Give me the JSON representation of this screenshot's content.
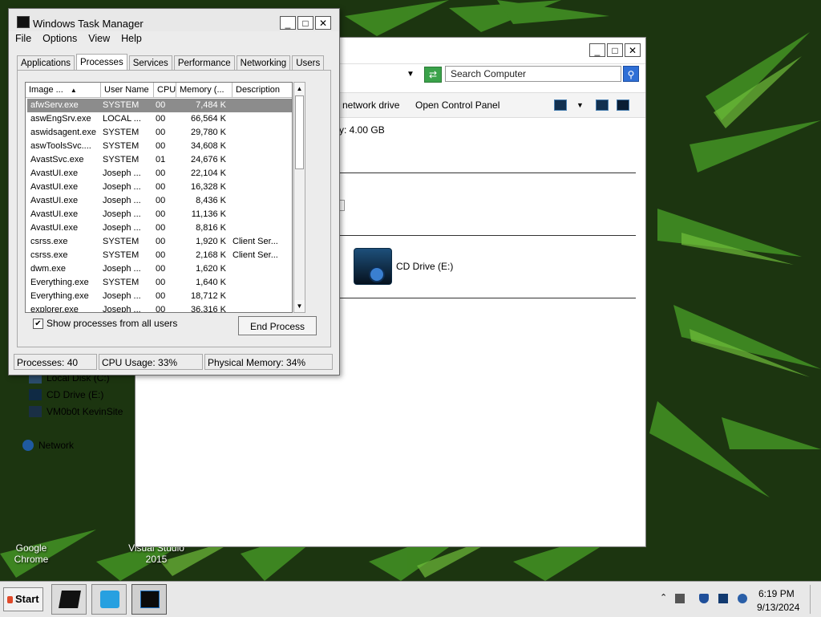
{
  "desktop": {
    "icons": [
      {
        "label1": "Google",
        "label2": "Chrome"
      },
      {
        "label1": "Visual Studio",
        "label2": "2015"
      }
    ]
  },
  "explorer": {
    "search_placeholder": "Search Computer",
    "commands": {
      "map_network_drive": "network drive",
      "open_control_panel": "Open Control Panel"
    },
    "memory_text": "y:  4.00 GB",
    "cd_drive_label": "CD Drive (E:)",
    "nav": {
      "local_disk": "Local Disk (C:)",
      "cd_drive": "CD Drive (E:)",
      "network_share": "VM0b0t KevinSite",
      "network": "Network"
    }
  },
  "taskmgr": {
    "title": "Windows Task Manager",
    "menu": [
      "File",
      "Options",
      "View",
      "Help"
    ],
    "tabs": [
      "Applications",
      "Processes",
      "Services",
      "Performance",
      "Networking",
      "Users"
    ],
    "active_tab": "Processes",
    "columns": [
      "Image ...",
      "User Name",
      "CPU",
      "Memory (...",
      "Description"
    ],
    "rows": [
      {
        "image": "afwServ.exe",
        "user": "SYSTEM",
        "cpu": "00",
        "mem": "7,484 K",
        "desc": ""
      },
      {
        "image": "aswEngSrv.exe",
        "user": "LOCAL ...",
        "cpu": "00",
        "mem": "66,564 K",
        "desc": ""
      },
      {
        "image": "aswidsagent.exe",
        "user": "SYSTEM",
        "cpu": "00",
        "mem": "29,780 K",
        "desc": ""
      },
      {
        "image": "aswToolsSvc....",
        "user": "SYSTEM",
        "cpu": "00",
        "mem": "34,608 K",
        "desc": ""
      },
      {
        "image": "AvastSvc.exe",
        "user": "SYSTEM",
        "cpu": "01",
        "mem": "24,676 K",
        "desc": ""
      },
      {
        "image": "AvastUI.exe",
        "user": "Joseph ...",
        "cpu": "00",
        "mem": "22,104 K",
        "desc": ""
      },
      {
        "image": "AvastUI.exe",
        "user": "Joseph ...",
        "cpu": "00",
        "mem": "16,328 K",
        "desc": ""
      },
      {
        "image": "AvastUI.exe",
        "user": "Joseph ...",
        "cpu": "00",
        "mem": "8,436 K",
        "desc": ""
      },
      {
        "image": "AvastUI.exe",
        "user": "Joseph ...",
        "cpu": "00",
        "mem": "11,136 K",
        "desc": ""
      },
      {
        "image": "AvastUI.exe",
        "user": "Joseph ...",
        "cpu": "00",
        "mem": "8,816 K",
        "desc": ""
      },
      {
        "image": "csrss.exe",
        "user": "SYSTEM",
        "cpu": "00",
        "mem": "1,920 K",
        "desc": "Client Ser..."
      },
      {
        "image": "csrss.exe",
        "user": "SYSTEM",
        "cpu": "00",
        "mem": "2,168 K",
        "desc": "Client Ser..."
      },
      {
        "image": "dwm.exe",
        "user": "Joseph ...",
        "cpu": "00",
        "mem": "1,620 K",
        "desc": ""
      },
      {
        "image": "Everything.exe",
        "user": "SYSTEM",
        "cpu": "00",
        "mem": "1,640 K",
        "desc": ""
      },
      {
        "image": "Everything.exe",
        "user": "Joseph ...",
        "cpu": "00",
        "mem": "18,712 K",
        "desc": ""
      },
      {
        "image": "explorer.exe",
        "user": "Joseph ...",
        "cpu": "00",
        "mem": "36,316 K",
        "desc": ""
      }
    ],
    "show_all_label": "Show processes from all users",
    "show_all_checked": "✔",
    "end_process": "End Process",
    "status": {
      "processes": "Processes: 40",
      "cpu": "CPU Usage: 33%",
      "memory": "Physical Memory: 34%"
    }
  },
  "taskbar": {
    "start": "Start",
    "time": "6:19 PM",
    "date": "9/13/2024"
  }
}
